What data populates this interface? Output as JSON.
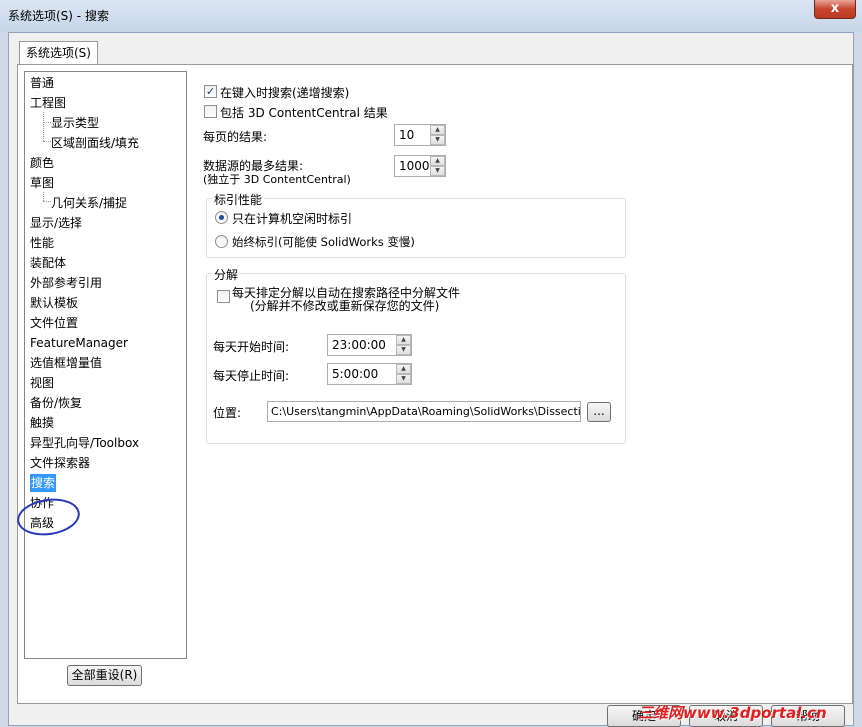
{
  "window": {
    "title": "系统选项(S) - 搜索",
    "close_label": "x"
  },
  "tab": {
    "label": "系统选项(S)"
  },
  "tree": {
    "items": [
      {
        "label": "普通",
        "child": false
      },
      {
        "label": "工程图",
        "child": false
      },
      {
        "label": "显示类型",
        "child": true
      },
      {
        "label": "区域剖面线/填充",
        "child": true
      },
      {
        "label": "颜色",
        "child": false
      },
      {
        "label": "草图",
        "child": false
      },
      {
        "label": "几何关系/捕捉",
        "child": true
      },
      {
        "label": "显示/选择",
        "child": false
      },
      {
        "label": "性能",
        "child": false
      },
      {
        "label": "装配体",
        "child": false
      },
      {
        "label": "外部参考引用",
        "child": false
      },
      {
        "label": "默认模板",
        "child": false
      },
      {
        "label": "文件位置",
        "child": false
      },
      {
        "label": "FeatureManager",
        "child": false
      },
      {
        "label": "选值框增量值",
        "child": false
      },
      {
        "label": "视图",
        "child": false
      },
      {
        "label": "备份/恢复",
        "child": false
      },
      {
        "label": "触摸",
        "child": false
      },
      {
        "label": "异型孔向导/Toolbox",
        "child": false
      },
      {
        "label": "文件探索器",
        "child": false
      },
      {
        "label": "搜索",
        "child": false,
        "selected": true
      },
      {
        "label": "协作",
        "child": false
      },
      {
        "label": "高级",
        "child": false
      }
    ],
    "reset_label": "全部重设(R)"
  },
  "search": {
    "search_while_typing": {
      "label": "在键入时搜索(递增搜索)",
      "checked": true
    },
    "include_3dcc": {
      "label": "包括 3D ContentCentral 结果",
      "checked": false
    },
    "results_per_page": {
      "label": "每页的结果:",
      "value": "10"
    },
    "max_results": {
      "label": "数据源的最多结果:",
      "sublabel": "(独立于 3D ContentCentral)",
      "value": "1000"
    }
  },
  "indexing": {
    "title": "标引性能",
    "options": [
      {
        "label": "只在计算机空闲时标引",
        "selected": true
      },
      {
        "label": "始终标引(可能使 SolidWorks 变慢)",
        "selected": false
      }
    ]
  },
  "dissection": {
    "title": "分解",
    "schedule": {
      "label": "每天排定分解以自动在搜索路径中分解文件",
      "sublabel": "(分解并不修改或重新保存您的文件)",
      "checked": false
    },
    "start_time": {
      "label": "每天开始时间:",
      "value": "23:00:00"
    },
    "stop_time": {
      "label": "每天停止时间:",
      "value": "5:00:00"
    },
    "location": {
      "label": "位置:",
      "value": "C:\\Users\\tangmin\\AppData\\Roaming\\SolidWorks\\Dissection",
      "browse_label": "..."
    }
  },
  "footer": {
    "ok_label": "确定",
    "cancel_label": "取消",
    "help_label": "帮助"
  },
  "watermark": "三维网www.3dportal.cn"
}
